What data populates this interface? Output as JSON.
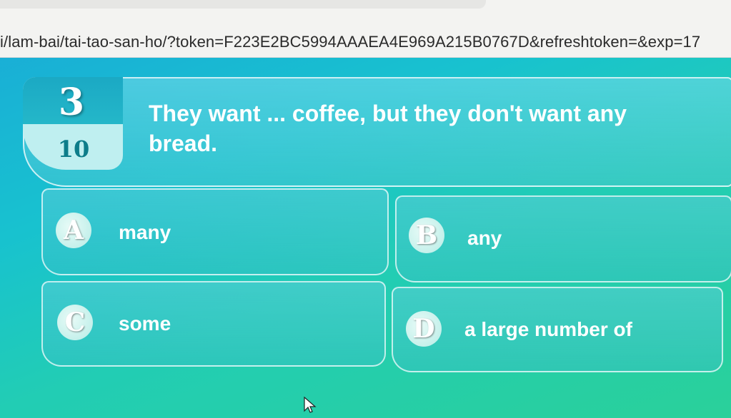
{
  "browser": {
    "url": "i/lam-bai/tai-tao-san-ho/?token=F223E2BC5994AAAEA4E969A215B0767D&refreshtoken=&exp=17"
  },
  "question": {
    "number": "3",
    "total": "10",
    "text": "They want ... coffee, but they don't want any bread."
  },
  "options": [
    {
      "letter": "A",
      "text": "many"
    },
    {
      "letter": "B",
      "text": "any"
    },
    {
      "letter": "C",
      "text": "some"
    },
    {
      "letter": "D",
      "text": "a large number of"
    }
  ],
  "colors": {
    "background_start": "#1aa9d8",
    "background_end": "#2ad09a",
    "badge_dark": "#1ba9c4",
    "badge_light": "#bfeff0",
    "text": "#ffffff"
  },
  "icons": {
    "cursor": "mouse-pointer-icon"
  }
}
